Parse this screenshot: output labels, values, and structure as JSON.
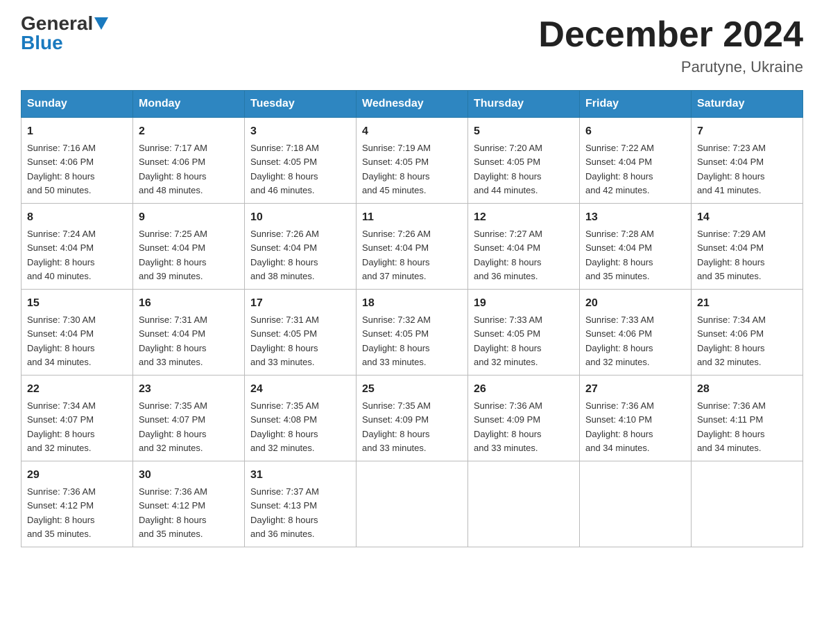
{
  "header": {
    "logo_general": "General",
    "logo_blue": "Blue",
    "month_title": "December 2024",
    "location": "Parutyne, Ukraine"
  },
  "days_of_week": [
    "Sunday",
    "Monday",
    "Tuesday",
    "Wednesday",
    "Thursday",
    "Friday",
    "Saturday"
  ],
  "weeks": [
    [
      {
        "day": "1",
        "sunrise": "7:16 AM",
        "sunset": "4:06 PM",
        "daylight": "8 hours and 50 minutes."
      },
      {
        "day": "2",
        "sunrise": "7:17 AM",
        "sunset": "4:06 PM",
        "daylight": "8 hours and 48 minutes."
      },
      {
        "day": "3",
        "sunrise": "7:18 AM",
        "sunset": "4:05 PM",
        "daylight": "8 hours and 46 minutes."
      },
      {
        "day": "4",
        "sunrise": "7:19 AM",
        "sunset": "4:05 PM",
        "daylight": "8 hours and 45 minutes."
      },
      {
        "day": "5",
        "sunrise": "7:20 AM",
        "sunset": "4:05 PM",
        "daylight": "8 hours and 44 minutes."
      },
      {
        "day": "6",
        "sunrise": "7:22 AM",
        "sunset": "4:04 PM",
        "daylight": "8 hours and 42 minutes."
      },
      {
        "day": "7",
        "sunrise": "7:23 AM",
        "sunset": "4:04 PM",
        "daylight": "8 hours and 41 minutes."
      }
    ],
    [
      {
        "day": "8",
        "sunrise": "7:24 AM",
        "sunset": "4:04 PM",
        "daylight": "8 hours and 40 minutes."
      },
      {
        "day": "9",
        "sunrise": "7:25 AM",
        "sunset": "4:04 PM",
        "daylight": "8 hours and 39 minutes."
      },
      {
        "day": "10",
        "sunrise": "7:26 AM",
        "sunset": "4:04 PM",
        "daylight": "8 hours and 38 minutes."
      },
      {
        "day": "11",
        "sunrise": "7:26 AM",
        "sunset": "4:04 PM",
        "daylight": "8 hours and 37 minutes."
      },
      {
        "day": "12",
        "sunrise": "7:27 AM",
        "sunset": "4:04 PM",
        "daylight": "8 hours and 36 minutes."
      },
      {
        "day": "13",
        "sunrise": "7:28 AM",
        "sunset": "4:04 PM",
        "daylight": "8 hours and 35 minutes."
      },
      {
        "day": "14",
        "sunrise": "7:29 AM",
        "sunset": "4:04 PM",
        "daylight": "8 hours and 35 minutes."
      }
    ],
    [
      {
        "day": "15",
        "sunrise": "7:30 AM",
        "sunset": "4:04 PM",
        "daylight": "8 hours and 34 minutes."
      },
      {
        "day": "16",
        "sunrise": "7:31 AM",
        "sunset": "4:04 PM",
        "daylight": "8 hours and 33 minutes."
      },
      {
        "day": "17",
        "sunrise": "7:31 AM",
        "sunset": "4:05 PM",
        "daylight": "8 hours and 33 minutes."
      },
      {
        "day": "18",
        "sunrise": "7:32 AM",
        "sunset": "4:05 PM",
        "daylight": "8 hours and 33 minutes."
      },
      {
        "day": "19",
        "sunrise": "7:33 AM",
        "sunset": "4:05 PM",
        "daylight": "8 hours and 32 minutes."
      },
      {
        "day": "20",
        "sunrise": "7:33 AM",
        "sunset": "4:06 PM",
        "daylight": "8 hours and 32 minutes."
      },
      {
        "day": "21",
        "sunrise": "7:34 AM",
        "sunset": "4:06 PM",
        "daylight": "8 hours and 32 minutes."
      }
    ],
    [
      {
        "day": "22",
        "sunrise": "7:34 AM",
        "sunset": "4:07 PM",
        "daylight": "8 hours and 32 minutes."
      },
      {
        "day": "23",
        "sunrise": "7:35 AM",
        "sunset": "4:07 PM",
        "daylight": "8 hours and 32 minutes."
      },
      {
        "day": "24",
        "sunrise": "7:35 AM",
        "sunset": "4:08 PM",
        "daylight": "8 hours and 32 minutes."
      },
      {
        "day": "25",
        "sunrise": "7:35 AM",
        "sunset": "4:09 PM",
        "daylight": "8 hours and 33 minutes."
      },
      {
        "day": "26",
        "sunrise": "7:36 AM",
        "sunset": "4:09 PM",
        "daylight": "8 hours and 33 minutes."
      },
      {
        "day": "27",
        "sunrise": "7:36 AM",
        "sunset": "4:10 PM",
        "daylight": "8 hours and 34 minutes."
      },
      {
        "day": "28",
        "sunrise": "7:36 AM",
        "sunset": "4:11 PM",
        "daylight": "8 hours and 34 minutes."
      }
    ],
    [
      {
        "day": "29",
        "sunrise": "7:36 AM",
        "sunset": "4:12 PM",
        "daylight": "8 hours and 35 minutes."
      },
      {
        "day": "30",
        "sunrise": "7:36 AM",
        "sunset": "4:12 PM",
        "daylight": "8 hours and 35 minutes."
      },
      {
        "day": "31",
        "sunrise": "7:37 AM",
        "sunset": "4:13 PM",
        "daylight": "8 hours and 36 minutes."
      },
      null,
      null,
      null,
      null
    ]
  ],
  "labels": {
    "sunrise": "Sunrise:",
    "sunset": "Sunset:",
    "daylight": "Daylight:"
  }
}
